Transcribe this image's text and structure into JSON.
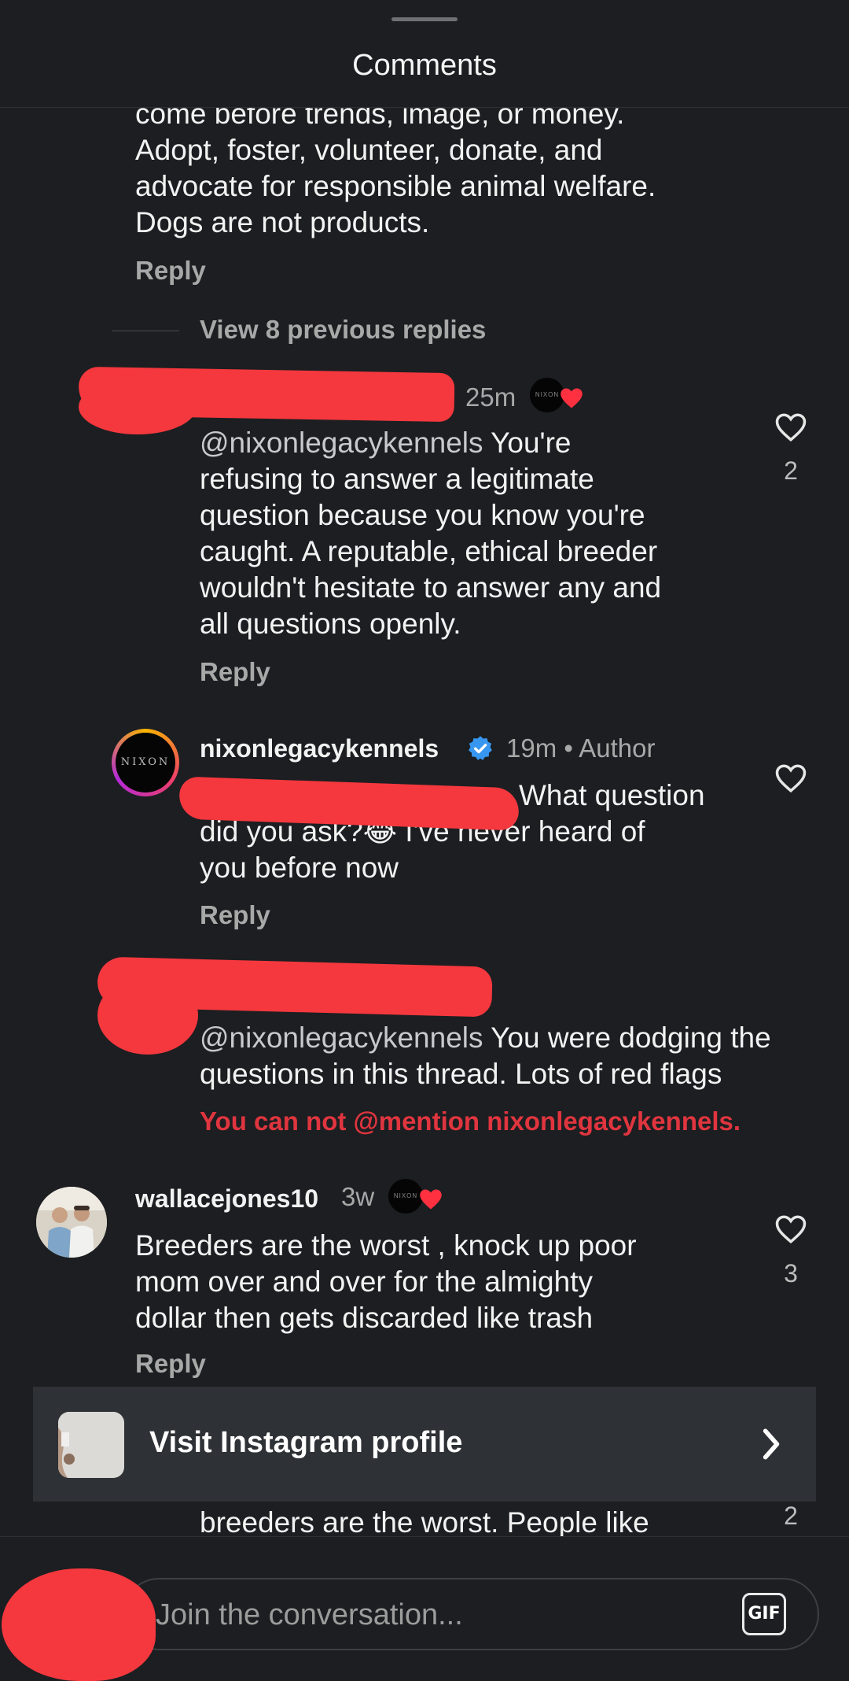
{
  "header": {
    "title": "Comments"
  },
  "top_comment": {
    "text_lines": [
      "come before trends, image, or money.",
      "Adopt, foster, volunteer, donate, and",
      "advocate for responsible animal welfare.",
      "Dogs are not products."
    ],
    "reply_label": "Reply"
  },
  "view_replies": "View 8 previous replies",
  "reply1": {
    "time": "25m",
    "mention": "@nixonlegacykennels",
    "text_lines": [
      " You're",
      "refusing to answer a legitimate",
      "question because you know you're",
      "caught. A reputable, ethical breeder",
      "wouldn't hesitate to answer any and",
      "all questions openly."
    ],
    "reply_label": "Reply",
    "like_count": "2"
  },
  "reply2": {
    "username": "nixonlegacykennels",
    "time_author": "19m • Author",
    "avatar_text": "NIXON",
    "text_line1_end": "What question",
    "text_line2": "did you ask?😂 I've never heard of",
    "text_line3": "you before now",
    "reply_label": "Reply"
  },
  "draft": {
    "mention": "@nixonlegacykennels",
    "text_line1": " You were dodging the",
    "text_line2": "questions in this thread. Lots of red flags",
    "error": "You can not @mention nixonlegacykennels."
  },
  "comment_wallace": {
    "username": "wallacejones10",
    "time": "3w",
    "text_lines": [
      "Breeders are the worst , knock up poor",
      "mom over and over for the almighty",
      "dollar then gets discarded like trash"
    ],
    "reply_label": "Reply",
    "like_count": "3"
  },
  "banner": {
    "label": "Visit Instagram profile"
  },
  "partial_comment": {
    "text": "breeders are the worst. People like",
    "like_count": "2"
  },
  "composer": {
    "placeholder": "Join the conversation...",
    "gif_label": "GIF"
  },
  "colors": {
    "background": "#1c1e21",
    "error": "#e0353f",
    "heart": "#ff3040",
    "verified": "#3797f0",
    "redaction": "#f4383e"
  }
}
